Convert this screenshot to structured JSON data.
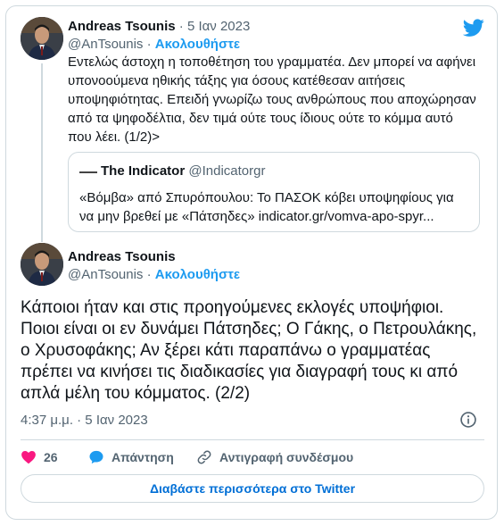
{
  "tweet1": {
    "author": "Andreas Tsounis",
    "separator": "·",
    "date": "5 Ιαν 2023",
    "handle": "@AnTsounis",
    "handle_separator": "·",
    "follow_label": "Ακολουθήστε",
    "text": "Εντελώς άστοχη η τοποθέτηση του γραμματέα. Δεν μπορεί να αφήνει υπονοούμενα ηθικής τάξης για όσους κατέθεσαν αιτήσεις υποψηφιότητας. Επειδή γνωρίζω τους ανθρώπους που αποχώρησαν από τα ψηφοδέλτια, δεν τιμά ούτε τους ίδιους ούτε το κόμμα αυτό που λέει. (1/2)>"
  },
  "quote": {
    "name": "The Indicator",
    "handle": "@Indicatorgr",
    "text": "«Βόμβα» από Σπυρόπουλου: Το ΠΑΣΟΚ κόβει υποψηφίους για να μην βρεθεί με «Πάτσηδες» indicator.gr/vomva-apo-spyr..."
  },
  "tweet2": {
    "author": "Andreas Tsounis",
    "handle": "@AnTsounis",
    "handle_separator": "·",
    "follow_label": "Ακολουθήστε",
    "text": "Κάποιοι ήταν και στις προηγούμενες εκλογές υποψήφιοι. Ποιοι είναι οι εν δυνάμει Πάτσηδες; Ο Γάκης, ο Πετρουλάκης, ο Χρυσοφάκης; Αν ξέρει κάτι παραπάνω ο γραμματέας πρέπει να κινήσει τις διαδικασίες για διαγραφή τους κι από απλά μέλη του κόμματος. (2/2)",
    "timestamp": "4:37 μ.μ. · 5 Ιαν 2023"
  },
  "actions": {
    "likes_count": "26",
    "reply_label": "Απάντηση",
    "copy_link_label": "Αντιγραφή συνδέσμου"
  },
  "read_more_label": "Διαβάστε περισσότερα στο Twitter",
  "colors": {
    "accent": "#1d9bf0",
    "like": "#f91880",
    "border": "#cfd9de",
    "secondary_text": "#536471"
  },
  "icons": [
    "twitter-bird-icon",
    "info-icon",
    "heart-icon",
    "reply-bubble-icon",
    "link-icon"
  ]
}
